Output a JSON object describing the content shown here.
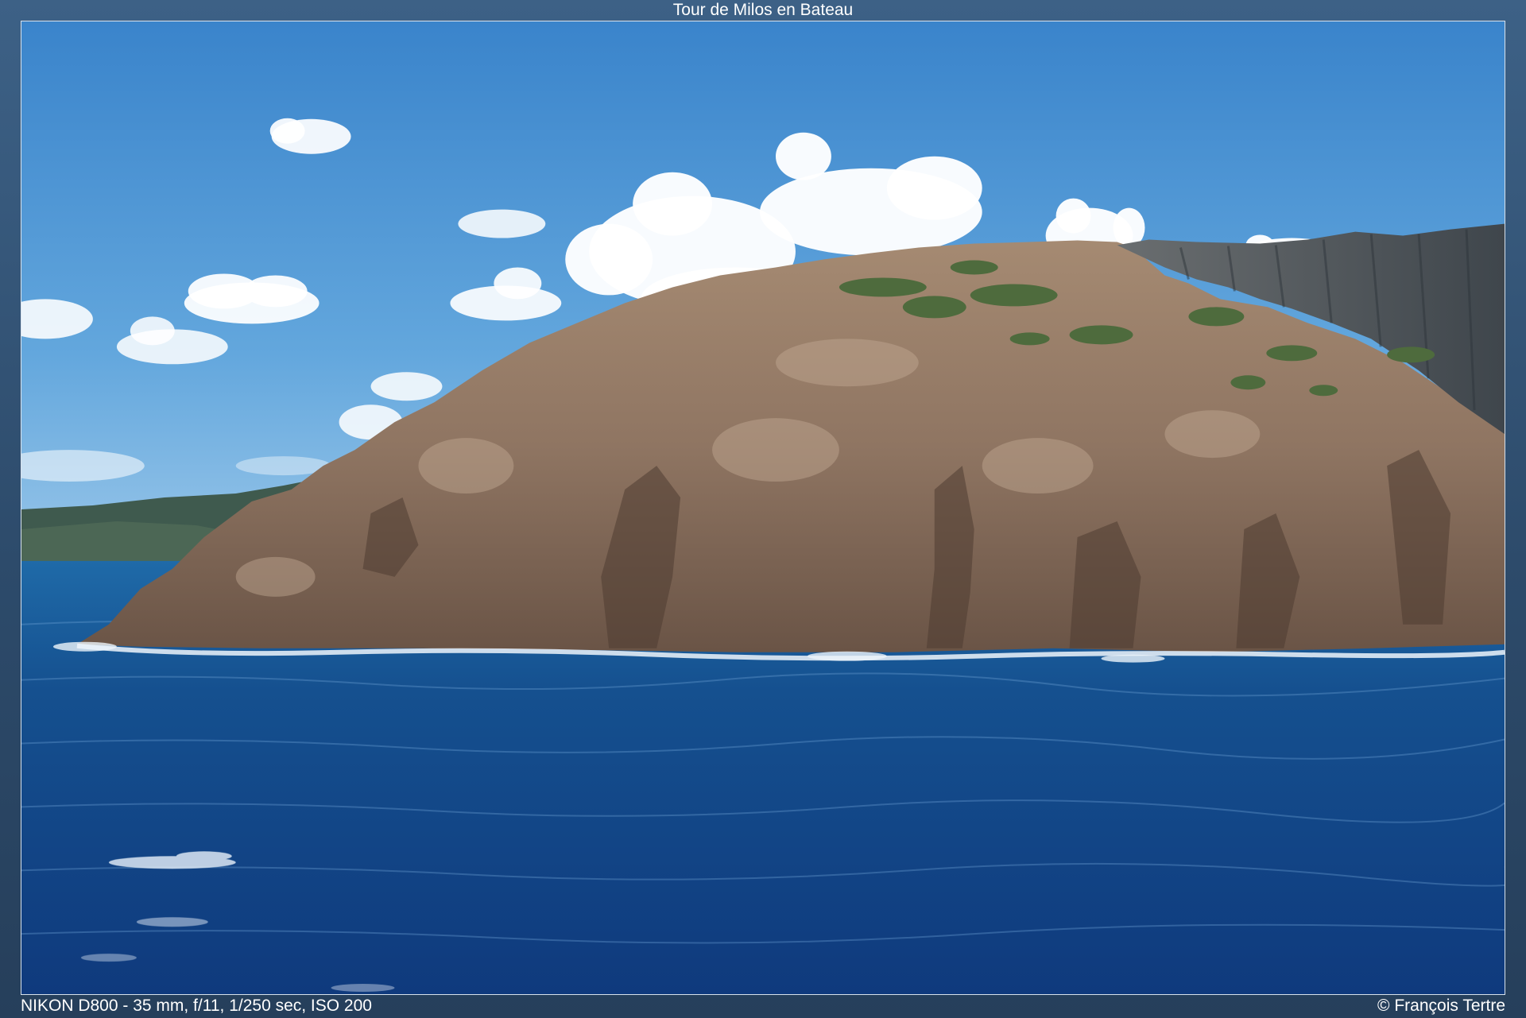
{
  "title": "Tour de Milos en Bateau",
  "photo": {
    "description_icon": "landscape-photo-icon",
    "exif": "NIKON D800 - 35 mm, f/11, 1/250 sec, ISO 200",
    "copyright": "© François Tertre"
  },
  "colors": {
    "background": "#2e4c6c",
    "sky_top": "#3b86cc",
    "sky_bottom": "#87bde6",
    "sea_top": "#1f6fb0",
    "sea_bottom": "#10387a",
    "rock": "#9c8068",
    "rock_shadow": "#5a4637",
    "vegetation": "#4b6a3c",
    "cliff": "#4f5760"
  }
}
